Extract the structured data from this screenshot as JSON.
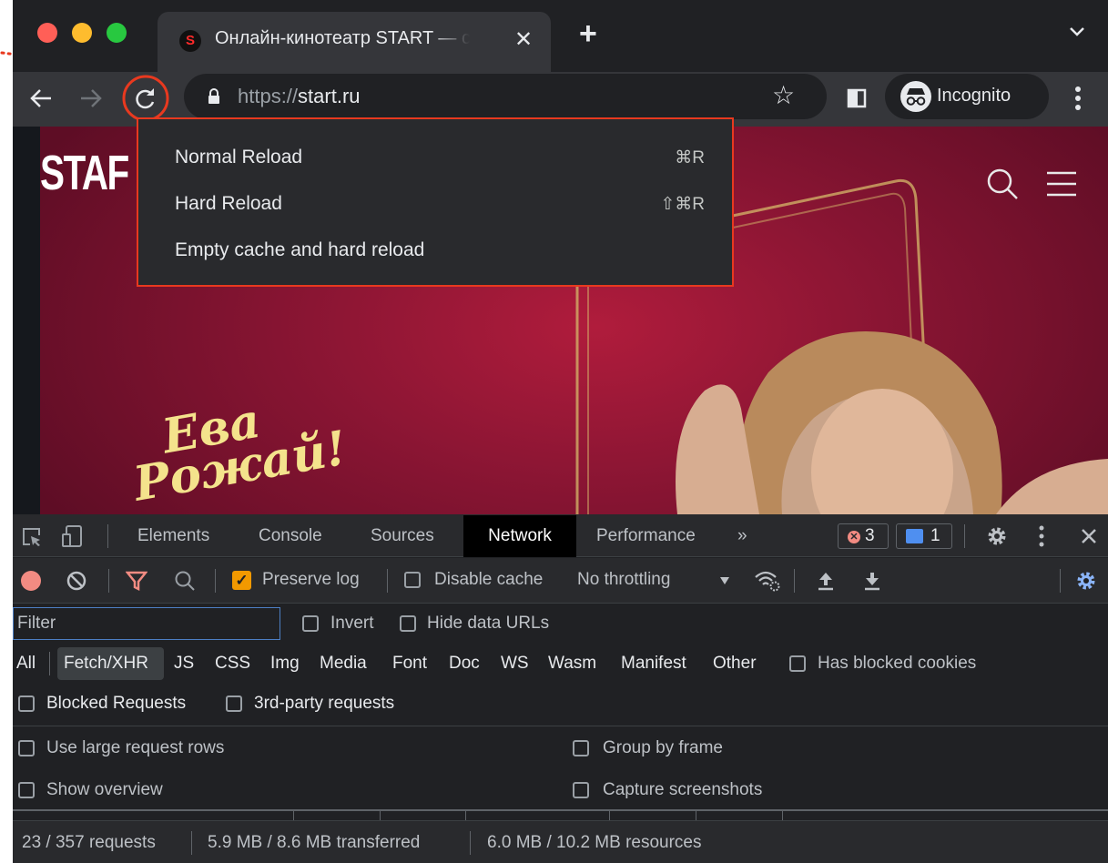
{
  "browser": {
    "tab": {
      "favicon_text": "S",
      "title": "Онлайн-кинотеатр START — с",
      "close_glyph": "✕"
    },
    "new_tab_glyph": "+",
    "url": {
      "scheme": "https://",
      "host": "start.ru"
    },
    "profile_label": "Incognito",
    "traffic_colors": [
      "#ff5f57",
      "#febc2e",
      "#28c840"
    ]
  },
  "page": {
    "logo_text": "STAF",
    "script_line1": "Ева",
    "script_line2": "Рожай!"
  },
  "reload_menu": {
    "items": [
      {
        "label": "Normal Reload",
        "shortcut": "⌘R"
      },
      {
        "label": "Hard Reload",
        "shortcut": "⇧⌘R"
      },
      {
        "label": "Empty cache and hard reload",
        "shortcut": ""
      }
    ],
    "highlight_color": "#e8391f"
  },
  "devtools": {
    "tabs": [
      "Elements",
      "Console",
      "Sources",
      "Network",
      "Performance"
    ],
    "active_tab": "Network",
    "more_tabs_glyph": "»",
    "error_count": "3",
    "message_count": "1",
    "toolbar": {
      "preserve_log": "Preserve log",
      "disable_cache": "Disable cache",
      "throttling": "No throttling"
    },
    "filter": {
      "placeholder": "Filter",
      "invert": "Invert",
      "hide_data_urls": "Hide data URLs"
    },
    "type_filters": [
      "All",
      "Fetch/XHR",
      "JS",
      "CSS",
      "Img",
      "Media",
      "Font",
      "Doc",
      "WS",
      "Wasm",
      "Manifest",
      "Other"
    ],
    "active_type": "Fetch/XHR",
    "has_blocked_cookies": "Has blocked cookies",
    "blocked_requests": "Blocked Requests",
    "third_party": "3rd-party requests",
    "settings": {
      "large_rows": "Use large request rows",
      "group_by_frame": "Group by frame",
      "show_overview": "Show overview",
      "capture_screenshots": "Capture screenshots"
    },
    "status": {
      "requests": "23 / 357 requests",
      "transferred": "5.9 MB / 8.6 MB transferred",
      "resources": "6.0 MB / 10.2 MB resources"
    },
    "accent_color": "#8ab4f8"
  }
}
